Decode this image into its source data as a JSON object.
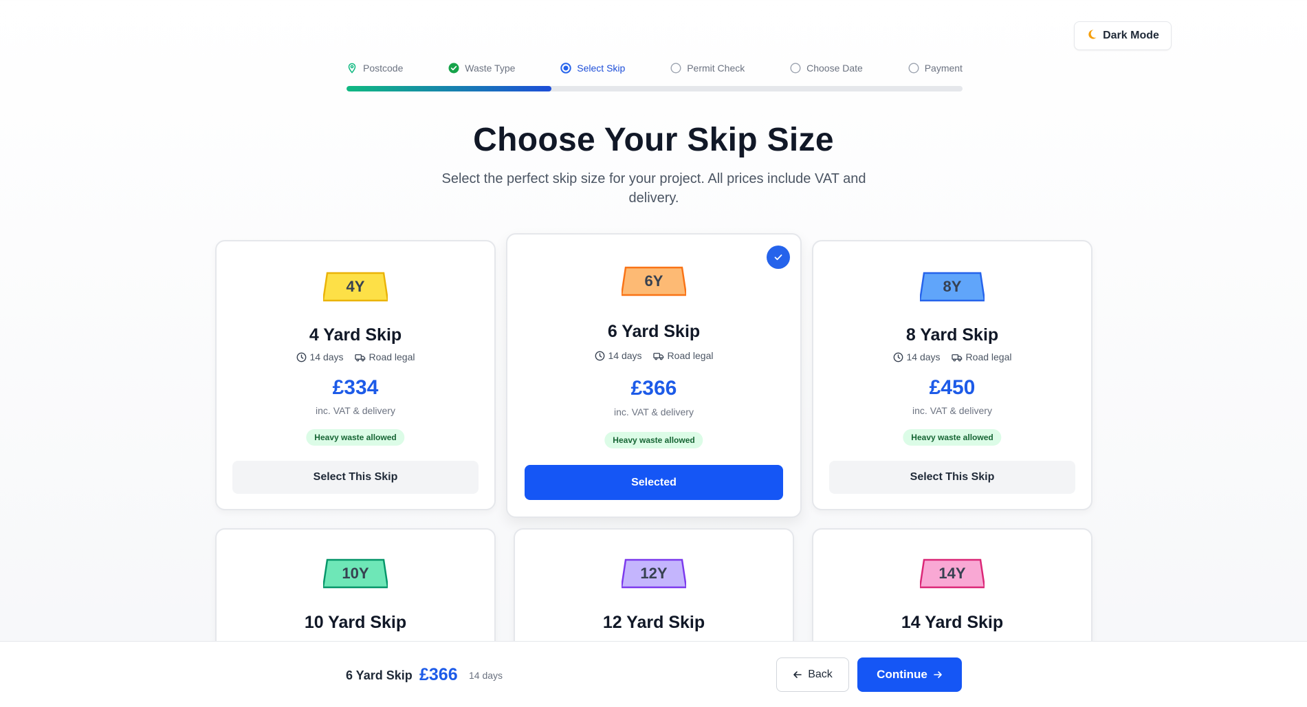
{
  "header": {
    "dark_mode_label": "Dark Mode"
  },
  "stepper": {
    "steps": [
      {
        "label": "Postcode",
        "state": "done",
        "icon": "map-pin-icon"
      },
      {
        "label": "Waste Type",
        "state": "done",
        "icon": "check-circle-icon"
      },
      {
        "label": "Select Skip",
        "state": "active",
        "icon": "radio-active-icon"
      },
      {
        "label": "Permit Check",
        "state": "pending",
        "icon": "circle-icon"
      },
      {
        "label": "Choose Date",
        "state": "pending",
        "icon": "circle-icon"
      },
      {
        "label": "Payment",
        "state": "pending",
        "icon": "circle-icon"
      }
    ],
    "progress_fraction": 0.333
  },
  "page": {
    "title": "Choose Your Skip Size",
    "subtitle": "Select the perfect skip size for your project. All prices include VAT and delivery."
  },
  "skips": [
    {
      "badge": "4Y",
      "name": "4 Yard Skip",
      "hire": "14 days",
      "road": "Road legal",
      "price": "£334",
      "note": "inc. VAT & delivery",
      "heavy": "Heavy waste allowed",
      "button": "Select This Skip",
      "color": "#fde047",
      "stroke": "#eab308"
    },
    {
      "badge": "6Y",
      "name": "6 Yard Skip",
      "hire": "14 days",
      "road": "Road legal",
      "price": "£366",
      "note": "inc. VAT & delivery",
      "heavy": "Heavy waste allowed",
      "button": "Selected",
      "color": "#fdba74",
      "stroke": "#f97316"
    },
    {
      "badge": "8Y",
      "name": "8 Yard Skip",
      "hire": "14 days",
      "road": "Road legal",
      "price": "£450",
      "note": "inc. VAT & delivery",
      "heavy": "Heavy waste allowed",
      "button": "Select This Skip",
      "color": "#60a5fa",
      "stroke": "#2563eb"
    },
    {
      "badge": "10Y",
      "name": "10 Yard Skip",
      "color": "#6ee7b7",
      "stroke": "#059669"
    },
    {
      "badge": "12Y",
      "name": "12 Yard Skip",
      "color": "#c4b5fd",
      "stroke": "#7c3aed"
    },
    {
      "badge": "14Y",
      "name": "14 Yard Skip",
      "color": "#f9a8d4",
      "stroke": "#db2777"
    }
  ],
  "summary": {
    "name": "6 Yard Skip",
    "price": "£366",
    "days": "14 days",
    "back_label": "Back",
    "continue_label": "Continue"
  }
}
